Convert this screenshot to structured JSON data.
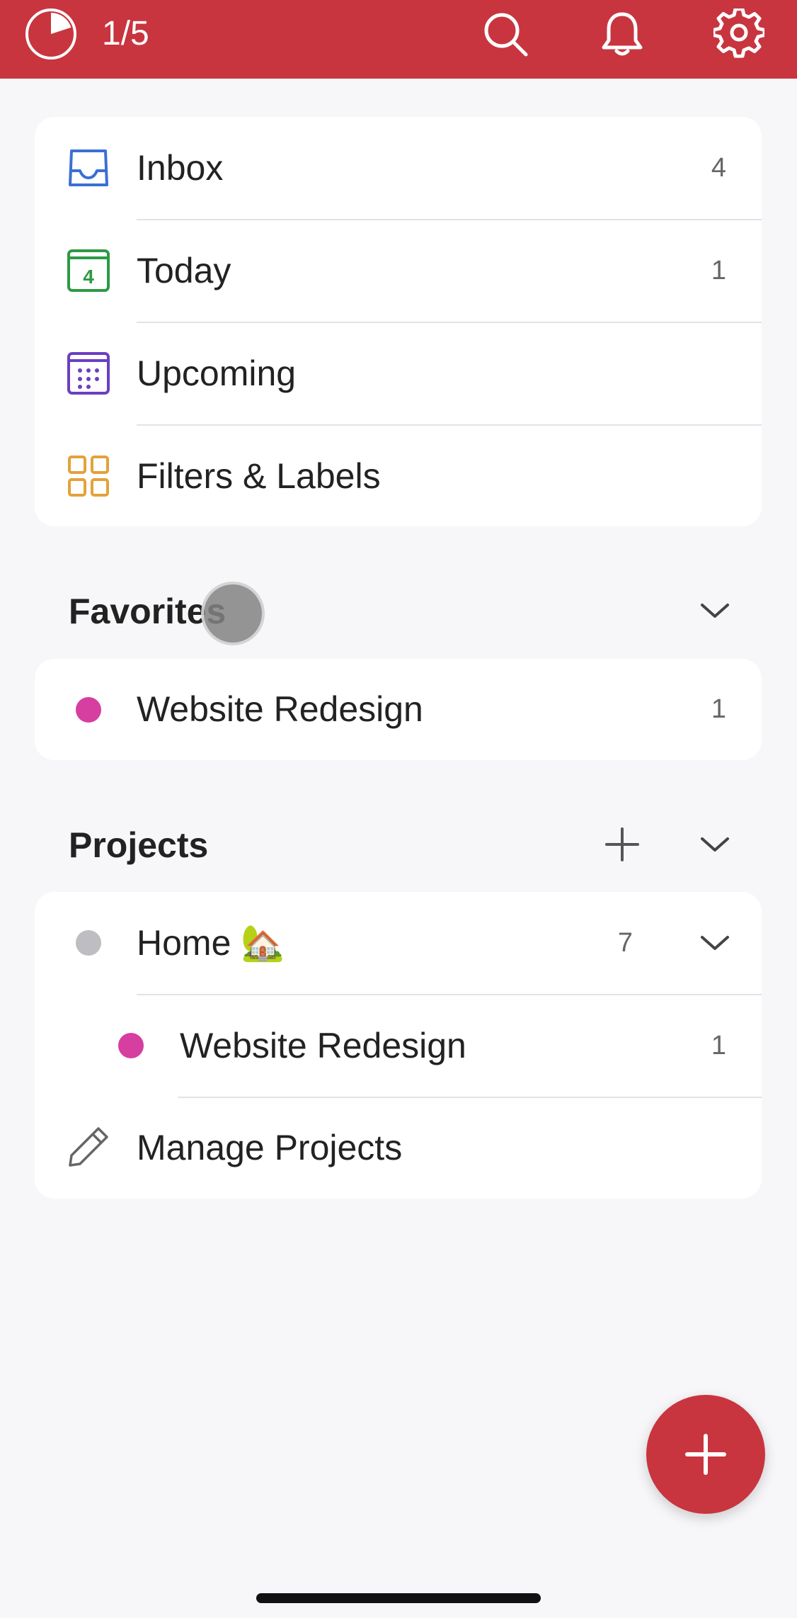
{
  "header": {
    "progress_text": "1/5",
    "progress_fraction": 0.2,
    "icons": [
      "progress-pie-icon",
      "search-icon",
      "bell-icon",
      "gear-icon"
    ],
    "bg_color": "#c8353f"
  },
  "nav": {
    "items": [
      {
        "label": "Inbox",
        "count": "4",
        "icon": "inbox-icon",
        "color": "#3b6fd4"
      },
      {
        "label": "Today",
        "count": "1",
        "icon": "calendar-today-icon",
        "day": "4",
        "color": "#2e9a43"
      },
      {
        "label": "Upcoming",
        "count": "",
        "icon": "calendar-upcoming-icon",
        "color": "#6b3fc2"
      },
      {
        "label": "Filters & Labels",
        "count": "",
        "icon": "filters-grid-icon",
        "color": "#e3a23a"
      }
    ]
  },
  "favorites": {
    "title": "Favorites",
    "items": [
      {
        "label": "Website Redesign",
        "count": "1",
        "color": "#d63ea0"
      }
    ]
  },
  "projects": {
    "title": "Projects",
    "items": [
      {
        "label": "Home 🏡",
        "count": "7",
        "color": "#bdbdc2"
      },
      {
        "label": "Website Redesign",
        "count": "1",
        "color": "#d63ea0"
      }
    ],
    "manage_label": "Manage Projects"
  },
  "fab": {
    "icon": "plus-icon",
    "color": "#c8353f"
  }
}
